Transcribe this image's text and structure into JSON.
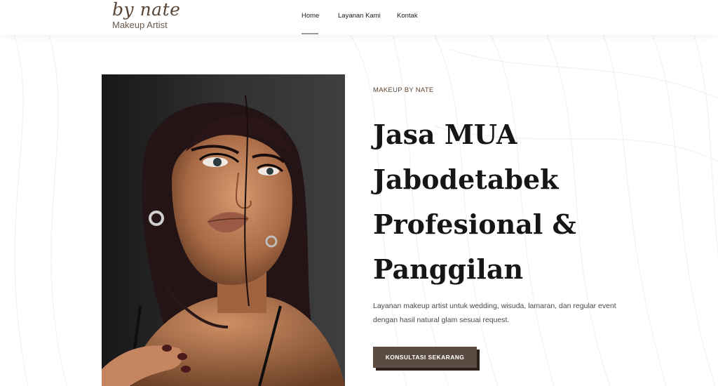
{
  "brand": {
    "script": "by nate",
    "subtitle": "Makeup Artist"
  },
  "nav": {
    "items": [
      {
        "label": "Home",
        "active": true
      },
      {
        "label": "Layanan Kami",
        "active": false
      },
      {
        "label": "Kontak",
        "active": false
      }
    ]
  },
  "hero": {
    "eyebrow": "MAKEUP BY NATE",
    "headline_lines": [
      "Jasa MUA",
      "Jabodetabek",
      "Profesional &",
      "Panggilan"
    ],
    "description": "Layanan makeup artist untuk wedding, wisuda, lamaran, dan regular event dengan hasil natural glam sesuai request.",
    "cta_label": "KONSULTASI SEKARANG"
  },
  "colors": {
    "brand_brown": "#5c4b40",
    "cta_shadow": "#2b211a",
    "heading": "#161616"
  }
}
